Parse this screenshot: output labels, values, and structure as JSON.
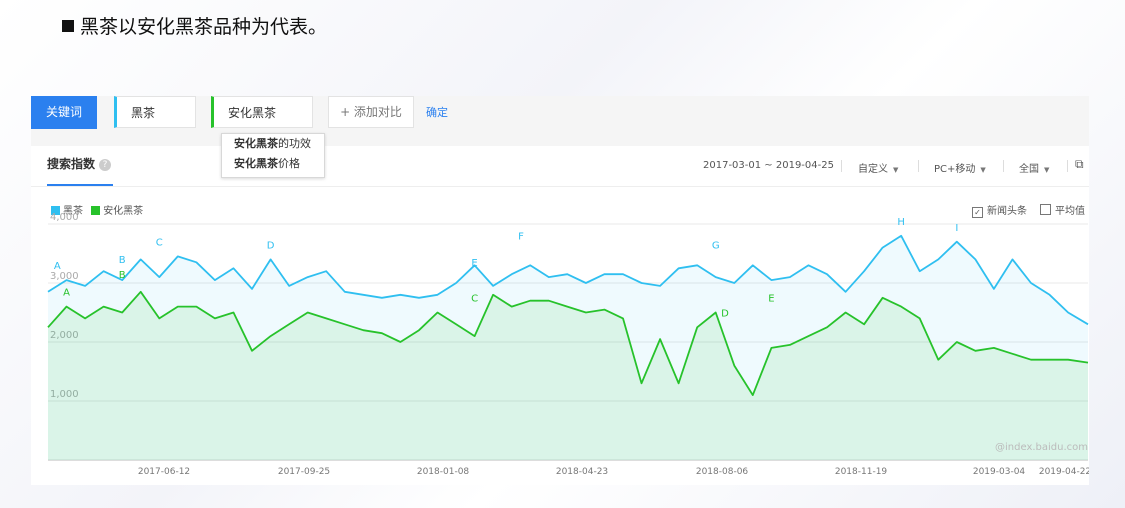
{
  "heading": "黑茶以安化黑茶品种为代表。",
  "toolbar": {
    "keyword_label": "关键词",
    "keywords": [
      "黑茶",
      "安化黑茶"
    ],
    "add_compare": "+ 添加对比",
    "confirm": "确定",
    "suggestions": [
      {
        "bold": "安化黑茶",
        "rest": "的功效"
      },
      {
        "bold": "安化黑茶",
        "rest": "价格"
      }
    ]
  },
  "tabbar": {
    "tab": "搜索指数",
    "date_range": "2017-03-01 ~ 2019-04-25",
    "custom": "自定义",
    "device": "PC+移动",
    "region": "全国"
  },
  "legend_options": {
    "news": "新闻头条",
    "average": "平均值"
  },
  "watermark": "@index.baidu.com",
  "colors": {
    "series1": "#2fbff0",
    "series2": "#27c22b",
    "accent": "#2b80ef"
  },
  "chart_data": {
    "type": "area",
    "xlabel": "",
    "ylabel": "",
    "ylim": [
      0,
      4000
    ],
    "yticks": [
      1000,
      2000,
      3000,
      4000
    ],
    "ytick_labels": [
      "1,000",
      "2,000",
      "3,000",
      "4,000"
    ],
    "x_ticks": [
      "2017-06-12",
      "2017-09-25",
      "2018-01-08",
      "2018-04-23",
      "2018-08-06",
      "2018-11-19",
      "2019-03-04",
      "2019-04-22"
    ],
    "grid": true,
    "legend": "top-left",
    "series": [
      {
        "name": "黑茶",
        "x": [
          "2017-03-01",
          "2017-03-15",
          "2017-03-29",
          "2017-04-12",
          "2017-04-26",
          "2017-05-10",
          "2017-05-24",
          "2017-06-07",
          "2017-06-21",
          "2017-07-05",
          "2017-07-19",
          "2017-08-02",
          "2017-08-16",
          "2017-08-30",
          "2017-09-13",
          "2017-09-27",
          "2017-10-11",
          "2017-10-25",
          "2017-11-08",
          "2017-11-22",
          "2017-12-06",
          "2017-12-20",
          "2018-01-03",
          "2018-01-17",
          "2018-01-31",
          "2018-02-14",
          "2018-02-28",
          "2018-03-14",
          "2018-03-28",
          "2018-04-11",
          "2018-04-25",
          "2018-05-09",
          "2018-05-23",
          "2018-06-06",
          "2018-06-20",
          "2018-07-04",
          "2018-07-18",
          "2018-08-01",
          "2018-08-15",
          "2018-08-29",
          "2018-09-12",
          "2018-09-26",
          "2018-10-10",
          "2018-10-24",
          "2018-11-07",
          "2018-11-21",
          "2018-12-05",
          "2018-12-19",
          "2019-01-02",
          "2019-01-16",
          "2019-01-30",
          "2019-02-13",
          "2019-02-27",
          "2019-03-13",
          "2019-03-27",
          "2019-04-10",
          "2019-04-25"
        ],
        "values": [
          2850,
          3050,
          2950,
          3200,
          3050,
          3400,
          3100,
          3450,
          3350,
          3050,
          3250,
          2900,
          3400,
          2950,
          3100,
          3200,
          2850,
          2800,
          2750,
          2800,
          2750,
          2800,
          3000,
          3300,
          2950,
          3150,
          3300,
          3100,
          3150,
          3000,
          3150,
          3150,
          3000,
          2950,
          3250,
          3300,
          3100,
          3000,
          3300,
          3050,
          3100,
          3300,
          3150,
          2850,
          3200,
          3600,
          3800,
          3200,
          3400,
          3700,
          3400,
          2900,
          3400,
          3000,
          2800,
          2500,
          2300
        ]
      },
      {
        "name": "安化黑茶",
        "x": [
          "2017-03-01",
          "2017-03-15",
          "2017-03-29",
          "2017-04-12",
          "2017-04-26",
          "2017-05-10",
          "2017-05-24",
          "2017-06-07",
          "2017-06-21",
          "2017-07-05",
          "2017-07-19",
          "2017-08-02",
          "2017-08-16",
          "2017-08-30",
          "2017-09-13",
          "2017-09-27",
          "2017-10-11",
          "2017-10-25",
          "2017-11-08",
          "2017-11-22",
          "2017-12-06",
          "2017-12-20",
          "2018-01-03",
          "2018-01-17",
          "2018-01-31",
          "2018-02-14",
          "2018-02-28",
          "2018-03-14",
          "2018-03-28",
          "2018-04-11",
          "2018-04-25",
          "2018-05-09",
          "2018-05-23",
          "2018-06-06",
          "2018-06-20",
          "2018-07-04",
          "2018-07-18",
          "2018-08-01",
          "2018-08-15",
          "2018-08-29",
          "2018-09-12",
          "2018-09-26",
          "2018-10-10",
          "2018-10-24",
          "2018-11-07",
          "2018-11-21",
          "2018-12-05",
          "2018-12-19",
          "2019-01-02",
          "2019-01-16",
          "2019-01-30",
          "2019-02-13",
          "2019-02-27",
          "2019-03-13",
          "2019-03-27",
          "2019-04-10",
          "2019-04-25"
        ],
        "values": [
          2250,
          2600,
          2400,
          2600,
          2500,
          2850,
          2400,
          2600,
          2600,
          2400,
          2500,
          1850,
          2100,
          2300,
          2500,
          2400,
          2300,
          2200,
          2150,
          2000,
          2200,
          2500,
          2300,
          2100,
          2800,
          2600,
          2700,
          2700,
          2600,
          2500,
          2550,
          2400,
          1300,
          2050,
          1300,
          2250,
          2500,
          1600,
          1100,
          1900,
          1950,
          2100,
          2250,
          2500,
          2300,
          2750,
          2600,
          2400,
          1700,
          2000,
          1850,
          1900,
          1800,
          1700,
          1700,
          1700,
          1650
        ]
      }
    ],
    "annotations": [
      {
        "series": "黑茶",
        "label": "A",
        "x": "2017-03-08",
        "y": 3100
      },
      {
        "series": "黑茶",
        "label": "B",
        "x": "2017-04-26",
        "y": 3200
      },
      {
        "series": "黑茶",
        "label": "C",
        "x": "2017-05-24",
        "y": 3500
      },
      {
        "series": "黑茶",
        "label": "D",
        "x": "2017-08-16",
        "y": 3450
      },
      {
        "series": "黑茶",
        "label": "E",
        "x": "2018-01-17",
        "y": 3150
      },
      {
        "series": "黑茶",
        "label": "F",
        "x": "2018-02-21",
        "y": 3600
      },
      {
        "series": "黑茶",
        "label": "G",
        "x": "2018-07-18",
        "y": 3450
      },
      {
        "series": "黑茶",
        "label": "H",
        "x": "2018-12-05",
        "y": 3850
      },
      {
        "series": "黑茶",
        "label": "I",
        "x": "2019-01-16",
        "y": 3750
      },
      {
        "series": "安化黑茶",
        "label": "A",
        "x": "2017-03-15",
        "y": 2650
      },
      {
        "series": "安化黑茶",
        "label": "B",
        "x": "2017-04-26",
        "y": 2950
      },
      {
        "series": "安化黑茶",
        "label": "C",
        "x": "2018-01-17",
        "y": 2550
      },
      {
        "series": "安化黑茶",
        "label": "D",
        "x": "2018-07-25",
        "y": 2300
      },
      {
        "series": "安化黑茶",
        "label": "E",
        "x": "2018-08-29",
        "y": 2550
      }
    ]
  }
}
